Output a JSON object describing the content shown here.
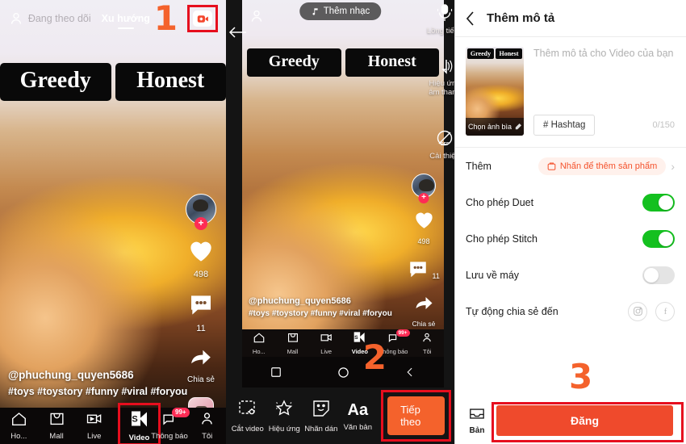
{
  "panel1": {
    "header": {
      "following_tab": "Đang theo dõi",
      "trending_tab": "Xu hướng",
      "record_icon": "camera-record-icon",
      "profile_icon": "person-icon"
    },
    "callout": "1",
    "overlay_text": {
      "left": "Greedy",
      "right": "Honest"
    },
    "rail": {
      "follow_plus": "+",
      "like_count": "498",
      "comment_count": "11",
      "share_label": "Chia sẻ"
    },
    "caption": {
      "username": "@phuchung_quyen5686",
      "hashtags": "#toys #toystory #funny #viral #foryou"
    },
    "nav": [
      {
        "label": "Ho...",
        "icon": "home-icon",
        "active": false
      },
      {
        "label": "Mall",
        "icon": "mall-icon",
        "active": false
      },
      {
        "label": "Live",
        "icon": "live-icon",
        "active": false
      },
      {
        "label": "Video",
        "icon": "video-icon",
        "active": true
      },
      {
        "label": "Thông báo",
        "icon": "bell-icon",
        "active": false,
        "badge": "99+"
      },
      {
        "label": "Tôi",
        "icon": "person-icon",
        "active": false
      }
    ]
  },
  "panel2": {
    "back_icon": "back-arrow-icon",
    "music_pill": "Thêm nhạc",
    "callout": "2",
    "tools": [
      {
        "label": "Lồng tiếng",
        "icon": "microphone-icon"
      },
      {
        "label": "Hiệu ứng âm thanh",
        "icon": "sound-effect-icon"
      },
      {
        "label": "Cải thiện",
        "icon": "enhance-off-icon"
      }
    ],
    "overlay_text": {
      "left": "Greedy",
      "right": "Honest"
    },
    "rail": {
      "like_count": "498",
      "comment_count": "11",
      "share_label": "Chia sẻ"
    },
    "caption": {
      "username": "@phuchung_quyen5686",
      "hashtags": "#toys #toystory #funny #viral #foryou"
    },
    "nav": [
      {
        "label": "Ho...",
        "icon": "home-icon",
        "active": false
      },
      {
        "label": "Mall",
        "icon": "mall-icon",
        "active": false
      },
      {
        "label": "Live",
        "icon": "live-icon",
        "active": false
      },
      {
        "label": "Video",
        "icon": "video-icon",
        "active": true
      },
      {
        "label": "Thông báo",
        "icon": "bell-icon",
        "active": false,
        "badge": "99+"
      },
      {
        "label": "Tôi",
        "icon": "person-icon",
        "active": false
      }
    ],
    "edit_tools": [
      {
        "label": "Cắt video",
        "icon": "trim-video-icon"
      },
      {
        "label": "Hiệu ứng",
        "icon": "effects-star-icon"
      },
      {
        "label": "Nhãn dán",
        "icon": "sticker-icon"
      },
      {
        "label": "Văn bản",
        "icon": "text-aa-icon"
      }
    ],
    "next_button": "Tiếp theo"
  },
  "panel3": {
    "back_icon": "back-chevron-icon",
    "title": "Thêm mô tả",
    "callout": "3",
    "thumbnail": {
      "left_text": "Greedy",
      "right_text": "Honest",
      "cover_label": "Chọn ảnh bìa"
    },
    "description_placeholder": "Thêm mô tả cho Video của bạn",
    "hashtag_button": "# Hashtag",
    "char_counter": "0/150",
    "rows": [
      {
        "label": "Thêm",
        "type": "product",
        "chip": "Nhấn để thêm sản phẩm",
        "chip_icon": "shopping-bag-icon"
      },
      {
        "label": "Cho phép Duet",
        "type": "toggle",
        "state": "on"
      },
      {
        "label": "Cho phép Stitch",
        "type": "toggle",
        "state": "on"
      },
      {
        "label": "Lưu về máy",
        "type": "toggle",
        "state": "off"
      },
      {
        "label": "Tự động chia sẻ đến",
        "type": "social",
        "icons": [
          "instagram-icon",
          "facebook-icon"
        ]
      }
    ],
    "draft_label": "Bản",
    "post_button": "Đăng"
  },
  "colors": {
    "accent_orange": "#f4622c",
    "post_red": "#ef4a2c",
    "highlight_red": "#e60e1e",
    "toggle_green": "#14c01f",
    "tiktok_pink": "#fe2c55"
  }
}
